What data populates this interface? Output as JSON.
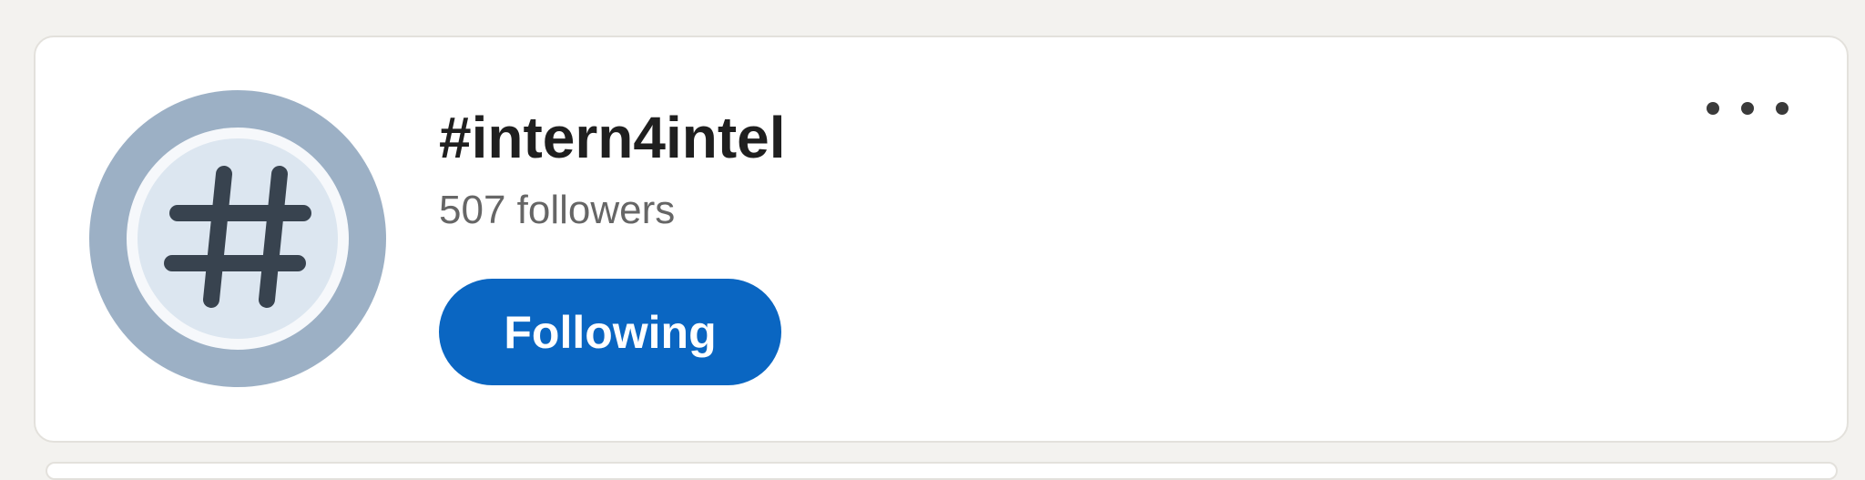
{
  "card": {
    "avatar_icon": "hashtag-icon",
    "title": "#intern4intel",
    "followers": "507 followers",
    "follow_button_label": "Following",
    "more_icon": "ellipsis-icon"
  },
  "colors": {
    "background": "#f3f2ef",
    "card": "#ffffff",
    "accent": "#0a66c2",
    "avatar_ring": "#9cb0c5",
    "avatar_inner": "#dce6f0",
    "hash_glyph": "#38434f"
  }
}
